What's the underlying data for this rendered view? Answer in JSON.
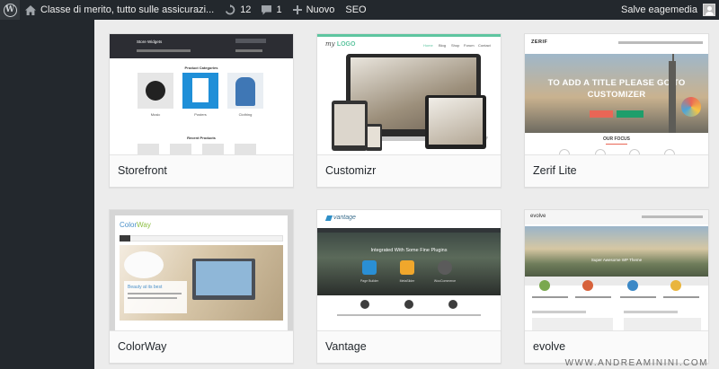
{
  "adminbar": {
    "site_title": "Classe di merito, tutto sulle assicurazi...",
    "updates_count": "12",
    "comments_count": "1",
    "new_label": "Nuovo",
    "seo_label": "SEO",
    "greeting": "Salve eagemedia"
  },
  "themes": [
    {
      "name": "Storefront",
      "shot": {
        "site": "Store Widgets",
        "section1": "Product Categories",
        "cat1": "Music",
        "cat2": "Posters",
        "cat3": "Clothing",
        "section2": "Recent Products"
      }
    },
    {
      "name": "Customizr",
      "shot": {
        "logo_a": "my ",
        "logo_b": "LOGO",
        "nav": [
          "Home",
          "Blog",
          "Shop",
          "Forum",
          "Contact"
        ]
      }
    },
    {
      "name": "Zerif Lite",
      "shot": {
        "logo": "ZERIF",
        "hero_line1": "TO ADD A TITLE PLEASE GO TO",
        "hero_line2": "CUSTOMIZER",
        "focus": "OUR FOCUS"
      }
    },
    {
      "name": "ColorWay",
      "shot": {
        "logo_a": "Color",
        "logo_b": "Way",
        "tagline": "Beauty at its best"
      }
    },
    {
      "name": "Vantage",
      "shot": {
        "logo": "vantage",
        "headline": "Integrated With Some Fine Plugins",
        "plugin1": "Page Builder",
        "plugin2": "MetaSlider",
        "plugin3": "WooCommerce"
      }
    },
    {
      "name": "evolve",
      "shot": {
        "logo": "evolve",
        "tagline": "Super Awesome WP Theme"
      }
    }
  ],
  "watermark": "WWW.ANDREAMININI.COM",
  "colors": {
    "adminbar": "#23282d",
    "content_bg": "#ececec",
    "card_label_bg": "#fafafa",
    "customizr_accent": "#5ec5a0",
    "zerif_cta": "#e96656"
  }
}
